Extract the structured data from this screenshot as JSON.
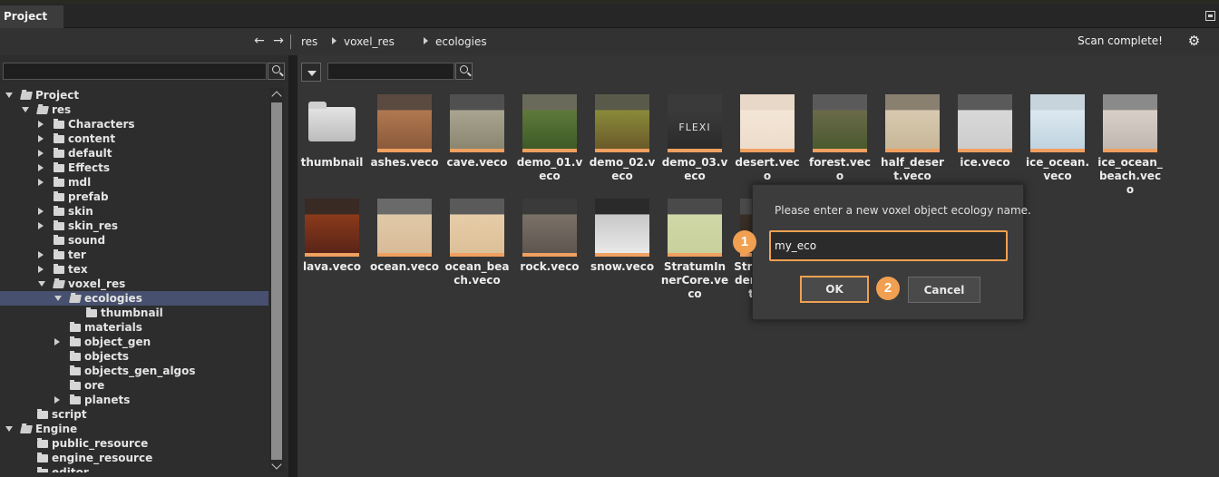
{
  "window": {
    "tab_label": "Project"
  },
  "nav": {
    "back_glyph": "←",
    "forward_glyph": "→",
    "breadcrumb": [
      "res",
      "voxel_res",
      "ecologies"
    ],
    "status": "Scan complete!",
    "settings_icon": "gear-icon"
  },
  "left": {
    "search_placeholder": "",
    "tree": [
      {
        "label": "Project",
        "depth": 0,
        "expander": "open"
      },
      {
        "label": "res",
        "depth": 1,
        "expander": "open"
      },
      {
        "label": "Characters",
        "depth": 2,
        "expander": "closed"
      },
      {
        "label": "content",
        "depth": 2,
        "expander": "closed"
      },
      {
        "label": "default",
        "depth": 2,
        "expander": "closed"
      },
      {
        "label": "Effects",
        "depth": 2,
        "expander": "closed"
      },
      {
        "label": "mdl",
        "depth": 2,
        "expander": "closed"
      },
      {
        "label": "prefab",
        "depth": 2,
        "expander": "none"
      },
      {
        "label": "skin",
        "depth": 2,
        "expander": "closed"
      },
      {
        "label": "skin_res",
        "depth": 2,
        "expander": "closed"
      },
      {
        "label": "sound",
        "depth": 2,
        "expander": "none"
      },
      {
        "label": "ter",
        "depth": 2,
        "expander": "closed"
      },
      {
        "label": "tex",
        "depth": 2,
        "expander": "closed"
      },
      {
        "label": "voxel_res",
        "depth": 2,
        "expander": "open"
      },
      {
        "label": "ecologies",
        "depth": 3,
        "expander": "open",
        "selected": true
      },
      {
        "label": "thumbnail",
        "depth": 4,
        "expander": "none"
      },
      {
        "label": "materials",
        "depth": 3,
        "expander": "none"
      },
      {
        "label": "object_gen",
        "depth": 3,
        "expander": "closed"
      },
      {
        "label": "objects",
        "depth": 3,
        "expander": "none"
      },
      {
        "label": "objects_gen_algos",
        "depth": 3,
        "expander": "none"
      },
      {
        "label": "ore",
        "depth": 3,
        "expander": "none"
      },
      {
        "label": "planets",
        "depth": 3,
        "expander": "closed"
      },
      {
        "label": "script",
        "depth": 1,
        "expander": "none"
      },
      {
        "label": "Engine",
        "depth": 0,
        "expander": "open"
      },
      {
        "label": "public_resource",
        "depth": 1,
        "expander": "none"
      },
      {
        "label": "engine_resource",
        "depth": 1,
        "expander": "none"
      },
      {
        "label": "editor",
        "depth": 1,
        "expander": "none"
      }
    ]
  },
  "right": {
    "search_placeholder": "",
    "files": [
      {
        "name": "thumbnail",
        "kind": "folder"
      },
      {
        "name": "ashes.veco",
        "kind": "file",
        "swatch": [
          "#5a4a40",
          "#b07850",
          "#8a5a3a"
        ]
      },
      {
        "name": "cave.veco",
        "kind": "file",
        "swatch": [
          "#505050",
          "#a8a490",
          "#8a8670"
        ]
      },
      {
        "name": "demo_01.veco",
        "kind": "file",
        "swatch": [
          "#6a6a5a",
          "#5e7a3a",
          "#3e5a28"
        ]
      },
      {
        "name": "demo_02.veco",
        "kind": "file",
        "swatch": [
          "#5a5a4a",
          "#8a8a3a",
          "#6a5a2a"
        ]
      },
      {
        "name": "demo_03.veco",
        "kind": "file",
        "swatch": [
          "#3a3a3a",
          "#3a3a3a",
          "#2a2a2a"
        ]
      },
      {
        "name": "desert.veco",
        "kind": "file",
        "swatch": [
          "#e8d8c8",
          "#f4e6d6",
          "#ecdccc"
        ]
      },
      {
        "name": "forest.veco",
        "kind": "file",
        "swatch": [
          "#5a5a5a",
          "#6a6a4a",
          "#4a5a2e"
        ]
      },
      {
        "name": "half_desert.veco",
        "kind": "file",
        "swatch": [
          "#8a8070",
          "#d8c8b0",
          "#c8b898"
        ]
      },
      {
        "name": "ice.veco",
        "kind": "file",
        "swatch": [
          "#5a5a5a",
          "#d8d8d8",
          "#cccccc"
        ]
      },
      {
        "name": "ice_ocean.veco",
        "kind": "file",
        "swatch": [
          "#c8d4dc",
          "#dce8f0",
          "#c0d4e0"
        ]
      },
      {
        "name": "ice_ocean_beach.veco",
        "kind": "file",
        "swatch": [
          "#8a8a8a",
          "#d8d0c8",
          "#c0b8b0"
        ]
      },
      {
        "name": "lava.veco",
        "kind": "file",
        "swatch": [
          "#3a2a24",
          "#8a3a1a",
          "#5a2418"
        ]
      },
      {
        "name": "ocean.veco",
        "kind": "file",
        "swatch": [
          "#6a6a6a",
          "#e0c8a8",
          "#d8bc98"
        ]
      },
      {
        "name": "ocean_beach.veco",
        "kind": "file",
        "swatch": [
          "#5a5a5a",
          "#e6cca8",
          "#dcc098"
        ]
      },
      {
        "name": "rock.veco",
        "kind": "file",
        "swatch": [
          "#3a3a3a",
          "#7a7066",
          "#5e5650"
        ]
      },
      {
        "name": "snow.veco",
        "kind": "file",
        "swatch": [
          "#2a2a2a",
          "#c8c8c8",
          "#e8e8e8"
        ]
      },
      {
        "name": "StratumInnerCore.veco",
        "kind": "file",
        "swatch": [
          "#4a4a4a",
          "#d0d8a8",
          "#c8d09c"
        ]
      },
      {
        "name": "StratumUnderflowLeft.veco",
        "kind": "file",
        "swatch": [
          "#4a4a4a",
          "#3a3028",
          "#2e2620"
        ]
      }
    ]
  },
  "dialog": {
    "prompt": "Please enter a new voxel object ecology name.",
    "input_value": "my_eco",
    "ok_label": "OK",
    "cancel_label": "Cancel",
    "marker_1": "1",
    "marker_2": "2",
    "accent": "#f0a050"
  },
  "visible_labels": {
    "demo_03_logo": "FLEXI",
    "partial_tile_line1": "Str",
    "partial_tile_line2": "ow",
    "partial_tile_line3": "le",
    "engine_last_partial": "edit"
  }
}
